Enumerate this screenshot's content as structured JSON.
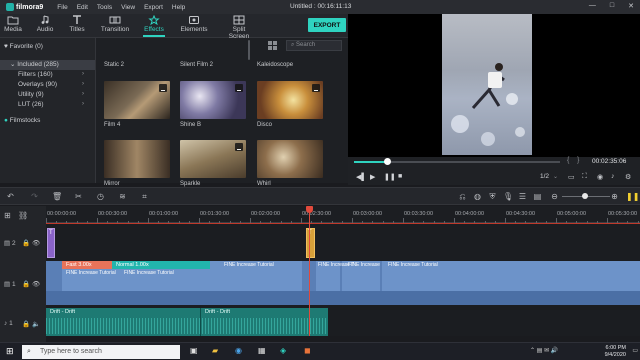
{
  "app": {
    "logo": "filmora9",
    "menu": [
      "File",
      "Edit",
      "Tools",
      "View",
      "Export",
      "Help"
    ],
    "window_title": "Untitled : 00:16:11:13",
    "window_controls": [
      "—",
      "□",
      "✕"
    ]
  },
  "toolbar": {
    "tabs": [
      {
        "label": "Media",
        "icon": "folder-icon"
      },
      {
        "label": "Audio",
        "icon": "music-note-icon"
      },
      {
        "label": "Titles",
        "icon": "text-T-icon"
      },
      {
        "label": "Transition",
        "icon": "transition-icon"
      },
      {
        "label": "Effects",
        "icon": "effects-icon"
      },
      {
        "label": "Elements",
        "icon": "elements-icon"
      },
      {
        "label": "Split Screen",
        "icon": "split-screen-icon"
      }
    ],
    "active_tab": "Effects",
    "export_label": "EXPORT"
  },
  "sidebar": {
    "favorite": "Favorite (0)",
    "included": "Included (285)",
    "items": [
      "Filters (160)",
      "Overlays (90)",
      "Utility (9)",
      "LUT (26)"
    ],
    "filmstocks": "Filmstocks"
  },
  "effects": {
    "search_placeholder": "Search",
    "row0": [
      "Static 2",
      "Silent Film 2",
      "Kaleidoscope"
    ],
    "row1": [
      "Film 4",
      "Shine B",
      "Disco"
    ],
    "row2": [
      "Mirror",
      "Sparkle",
      "Whirl"
    ]
  },
  "player": {
    "timecode": "00:02:35:06",
    "zoom_ratio": "1/2",
    "progress_fraction": 0.16
  },
  "timeline": {
    "ruler_labels": [
      "00:00:00:00",
      "00:00:30:00",
      "00:01:00:00",
      "00:01:30:00",
      "00:02:00:00",
      "00:02:30:00",
      "00:03:00:00",
      "00:03:30:00",
      "00:04:00:00",
      "00:04:30:00",
      "00:05:00:00",
      "00:05:30:00"
    ],
    "video_clips": [
      {
        "speed": "Fast 3.00x",
        "name": "FINE Increase Tutorial",
        "color": "#e8735a"
      },
      {
        "speed": "Normal 1.00x",
        "name": "FINE Increase Tutorial",
        "color": "#22b5ad"
      },
      {
        "speed": "",
        "name": "FINE Increase Tutorial",
        "color": "#6d93c9"
      },
      {
        "speed": "",
        "name": "FINE Increase T",
        "color": "#6d93c9"
      },
      {
        "speed": "",
        "name": "FINE Increase",
        "color": "#6d93c9"
      },
      {
        "speed": "",
        "name": "FINE Increase Tutorial",
        "color": "#6d93c9"
      }
    ],
    "audio_clips": [
      "Drift - Drift",
      "Drift - Drift"
    ],
    "track_labels": [
      "2",
      "1",
      "1"
    ]
  },
  "taskbar": {
    "search_placeholder": "Type here to search",
    "time": "6:00 PM",
    "date": "9/4/2020"
  }
}
